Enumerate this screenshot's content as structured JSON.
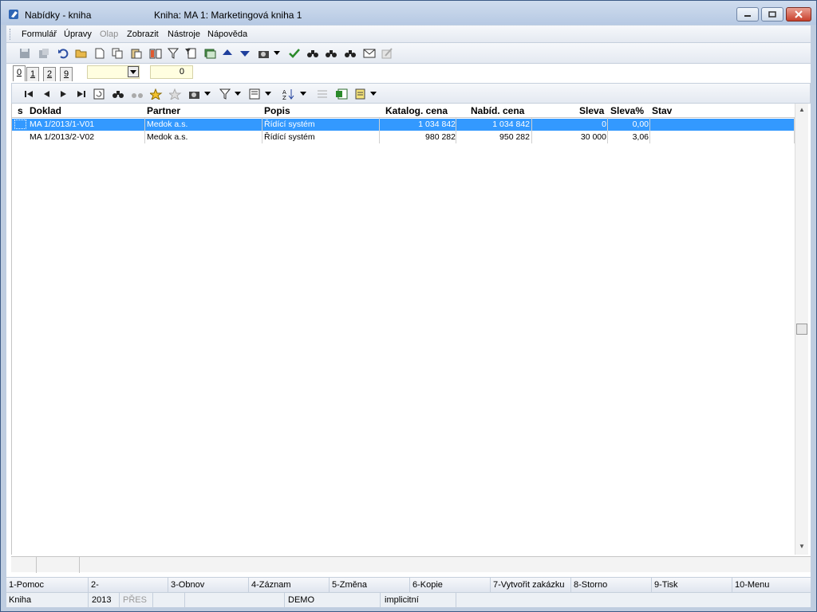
{
  "window": {
    "title": "Nabídky - kniha",
    "subtitle": "Kniha: MA 1: Marketingová kniha 1"
  },
  "menu": [
    {
      "label": "Formulář",
      "disabled": false
    },
    {
      "label": "Úpravy",
      "disabled": false
    },
    {
      "label": "Olap",
      "disabled": true
    },
    {
      "label": "Zobrazit",
      "disabled": false
    },
    {
      "label": "Nástroje",
      "disabled": false
    },
    {
      "label": "Nápověda",
      "disabled": false
    }
  ],
  "tabs": [
    "0",
    "1",
    "2",
    "9"
  ],
  "record_counter": "0",
  "grid": {
    "columns": {
      "s": "s",
      "doklad": "Doklad",
      "partner": "Partner",
      "popis": "Popis",
      "katalog": "Katalog. cena",
      "nabid": "Nabíd. cena",
      "sleva": "Sleva",
      "sleva_pct": "Sleva%",
      "stav": "Stav"
    },
    "rows": [
      {
        "doklad": "MA 1/2013/1-V01",
        "partner": "Medok a.s.",
        "popis": "Řídící systém",
        "katalog": "1 034 842",
        "nabid": "1 034 842",
        "sleva": "0",
        "sleva_pct": "0,00",
        "stav": ""
      },
      {
        "doklad": "MA 1/2013/2-V02",
        "partner": "Medok a.s.",
        "popis": "Řídící systém",
        "katalog": "980 282",
        "nabid": "950 282",
        "sleva": "30 000",
        "sleva_pct": "3,06",
        "stav": ""
      }
    ]
  },
  "fkeys": [
    "1-Pomoc",
    "2-",
    "3-Obnov",
    "4-Záznam",
    "5-Změna",
    "6-Kopie",
    "7-Vytvořit zakázku",
    "8-Storno",
    "9-Tisk",
    "10-Menu"
  ],
  "status": {
    "module": "Kniha",
    "year": "2013",
    "mode": "PŘES",
    "db": "DEMO",
    "profile": "implicitní"
  },
  "colors": {
    "selection": "#3399ff",
    "titlebar": "#c5d5ea"
  }
}
